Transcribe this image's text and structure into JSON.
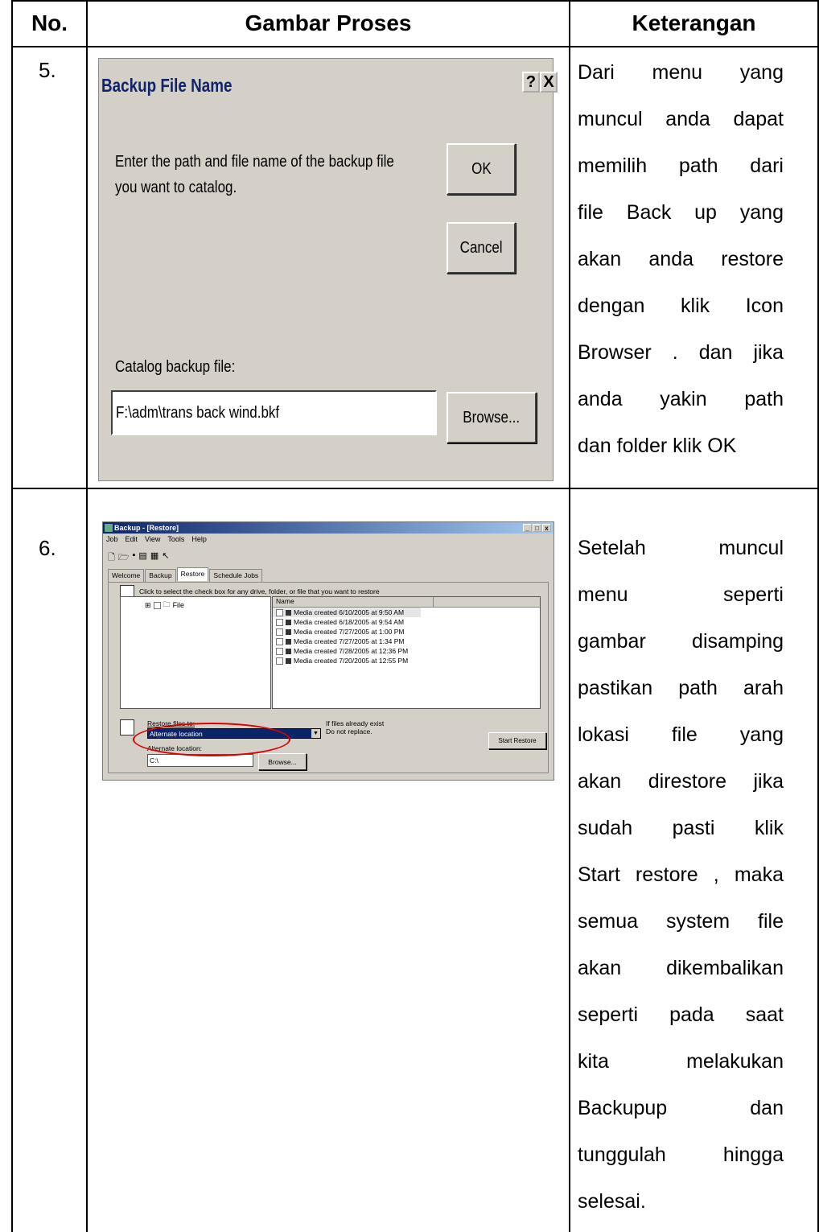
{
  "table": {
    "headers": [
      "No.",
      "Gambar Proses",
      "Keterangan"
    ],
    "rows": [
      {
        "no": "5.",
        "keterangan_lines": [
          [
            "Dari",
            "menu",
            "yang"
          ],
          [
            "muncul",
            "anda",
            "dapat"
          ],
          [
            "memilih",
            "path",
            "dari"
          ],
          [
            "file",
            "Back",
            "up",
            "yang"
          ],
          [
            "akan",
            "anda",
            "restore"
          ],
          [
            "dengan",
            "klik",
            "Icon"
          ],
          [
            "Browser",
            ".",
            "dan",
            "jika"
          ],
          [
            "anda",
            "yakin",
            "path"
          ],
          [
            "dan folder klik OK"
          ]
        ]
      },
      {
        "no": "6.",
        "keterangan_lines": [
          [
            "Setelah",
            "muncul"
          ],
          [
            "menu",
            "seperti"
          ],
          [
            "gambar",
            "disamping"
          ],
          [
            "pastikan",
            "path",
            "arah"
          ],
          [
            "lokasi",
            "file",
            "yang"
          ],
          [
            "akan",
            "direstore",
            "jika"
          ],
          [
            "sudah",
            "pasti",
            "klik"
          ],
          [
            "Start",
            "restore",
            ",",
            "maka"
          ],
          [
            "semua",
            "system",
            "file"
          ],
          [
            "akan",
            "dikembalikan"
          ],
          [
            "seperti",
            "pada",
            "saat"
          ],
          [
            "kita",
            "melakukan"
          ],
          [
            "Backupup",
            "dan"
          ],
          [
            "tunggulah",
            "hingga"
          ],
          [
            "selesai."
          ]
        ]
      }
    ]
  },
  "dialog1": {
    "title": "Backup File Name",
    "help_btn": "?",
    "close_btn": "X",
    "message": "Enter the path and file name of the backup file you want to catalog.",
    "ok": "OK",
    "cancel": "Cancel",
    "catalog_label": "Catalog backup file:",
    "catalog_value": "F:\\adm\\trans back wind.bkf",
    "browse": "Browse..."
  },
  "window2": {
    "title": "Backup - [Restore]",
    "controls": [
      "_",
      "□",
      "x"
    ],
    "menu": [
      "Job",
      "Edit",
      "View",
      "Tools",
      "Help"
    ],
    "tabs": [
      "Welcome",
      "Backup",
      "Restore",
      "Schedule Jobs"
    ],
    "instruction": "Click to select the check box for any drive, folder, or file that you want to restore",
    "tree_item": "File",
    "list_header": "Name",
    "list_items": [
      "Media created 6/10/2005 at 9:50 AM",
      "Media created 6/18/2005 at 9:54 AM",
      "Media created 7/27/2005 at 1:00 PM",
      "Media created 7/27/2005 at 1:34 PM",
      "Media created 7/28/2005 at 12:36 PM",
      "Media created 7/20/2005 at 12:55 PM"
    ],
    "restore_label": "Restore files to:",
    "restore_select": "Alternate location",
    "if_exist_1": "If files already exist",
    "if_exist_2": "Do not replace.",
    "start_restore": "Start Restore",
    "alt_label": "Alternate location:",
    "alt_value": "C:\\",
    "browse": "Browse..."
  },
  "colors": {
    "highlight": "#cc0000",
    "title_bar": "#0a246a",
    "dialog_bg": "#d4d0c8"
  }
}
